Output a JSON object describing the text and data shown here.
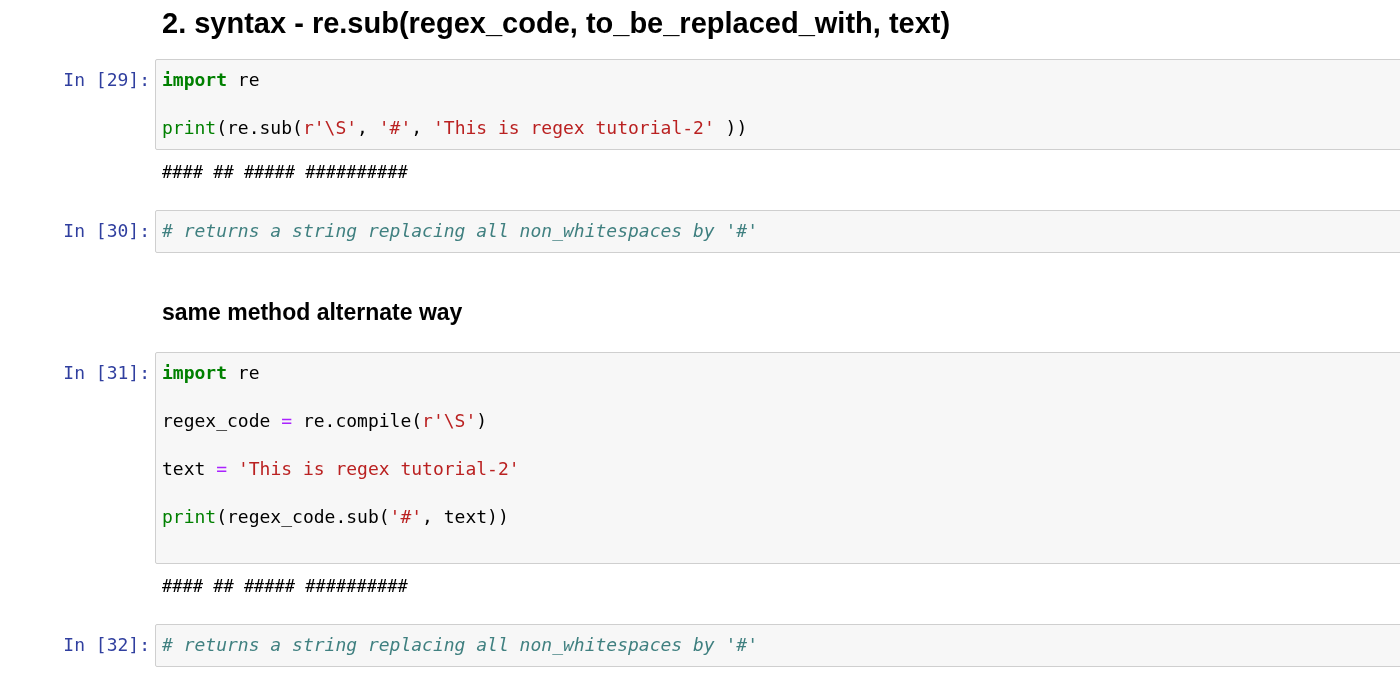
{
  "cells": [
    {
      "kind": "title",
      "text": "2. syntax - re.sub(regex_code, to_be_replaced_with, text)"
    },
    {
      "kind": "code",
      "prompt": "In [29]:",
      "lines": [
        [
          {
            "t": "import",
            "kind": "keyword"
          },
          {
            "t": " re",
            "kind": "plain"
          }
        ],
        [
          {
            "t": "print",
            "kind": "builtin"
          },
          {
            "t": "(re.sub(",
            "kind": "plain"
          },
          {
            "t": "r'\\S'",
            "kind": "string"
          },
          {
            "t": ", ",
            "kind": "plain"
          },
          {
            "t": "'#'",
            "kind": "string"
          },
          {
            "t": ", ",
            "kind": "plain"
          },
          {
            "t": "'This is regex tutorial-2'",
            "kind": "string"
          },
          {
            "t": " ))",
            "kind": "plain"
          }
        ]
      ],
      "trailing_blank": false,
      "output": "#### ## ##### ##########"
    },
    {
      "kind": "code",
      "prompt": "In [30]:",
      "lines": [
        [
          {
            "t": "# returns a string replacing all non_whitespaces by '#'",
            "kind": "comment"
          }
        ]
      ],
      "trailing_blank": false
    },
    {
      "kind": "subtitle",
      "text": "same method alternate way"
    },
    {
      "kind": "code",
      "prompt": "In [31]:",
      "lines": [
        [
          {
            "t": "import",
            "kind": "keyword"
          },
          {
            "t": " re",
            "kind": "plain"
          }
        ],
        [
          {
            "t": "regex_code ",
            "kind": "plain"
          },
          {
            "t": "=",
            "kind": "operator"
          },
          {
            "t": " re.compile(",
            "kind": "plain"
          },
          {
            "t": "r'\\S'",
            "kind": "string"
          },
          {
            "t": ")",
            "kind": "plain"
          }
        ],
        [
          {
            "t": "text ",
            "kind": "plain"
          },
          {
            "t": "= ",
            "kind": "operator"
          },
          {
            "t": "'This is regex tutorial-2'",
            "kind": "string"
          }
        ],
        [
          {
            "t": "print",
            "kind": "builtin"
          },
          {
            "t": "(regex_code.sub(",
            "kind": "plain"
          },
          {
            "t": "'#'",
            "kind": "string"
          },
          {
            "t": ", text))",
            "kind": "plain"
          }
        ]
      ],
      "trailing_blank": true,
      "output": "#### ## ##### ##########"
    },
    {
      "kind": "code",
      "prompt": "In [32]:",
      "lines": [
        [
          {
            "t": "# returns a string replacing all non_whitespaces by '#'",
            "kind": "comment"
          }
        ]
      ],
      "trailing_blank": false
    }
  ]
}
